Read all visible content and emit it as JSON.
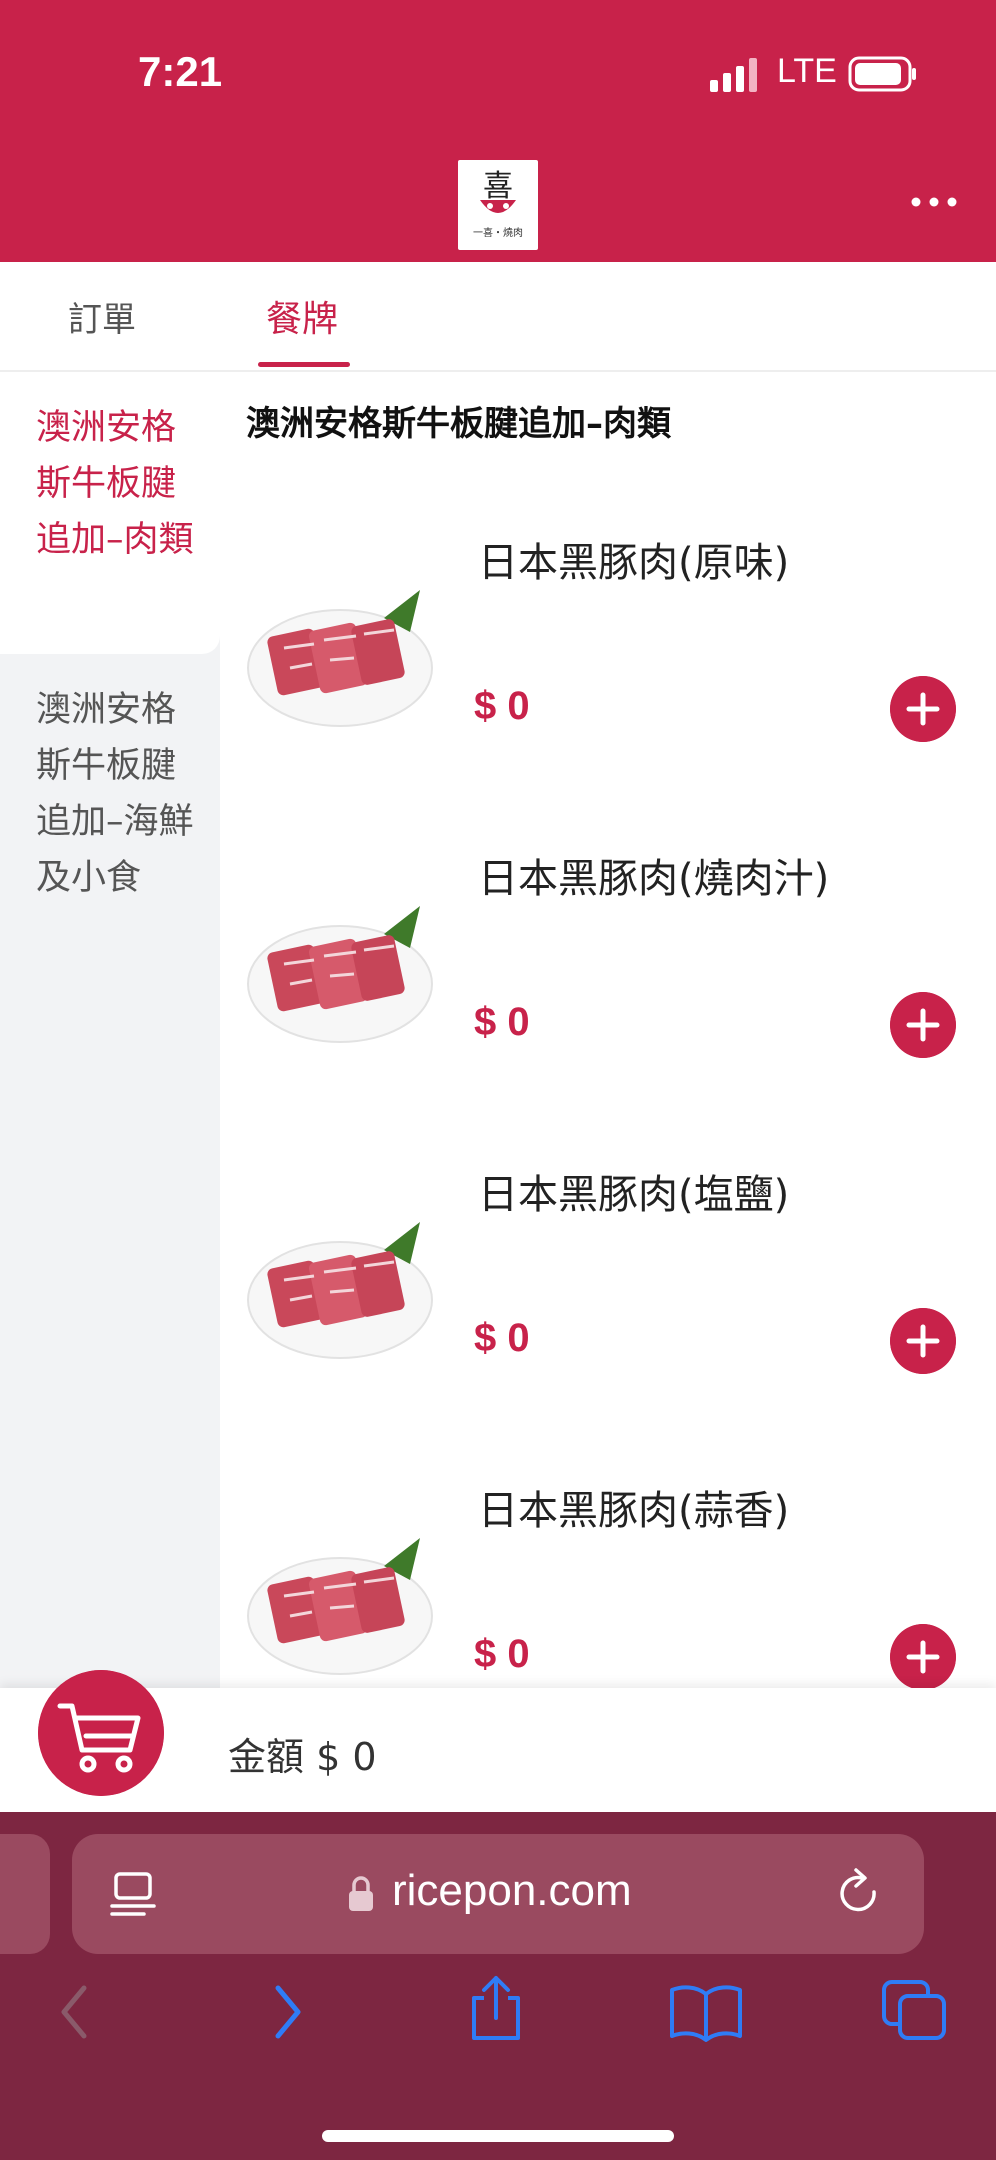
{
  "status_bar": {
    "time": "7:21",
    "network": "LTE"
  },
  "header": {
    "logo_text": "一喜・燒肉"
  },
  "tabs": [
    {
      "label": "訂單"
    },
    {
      "label": "餐牌"
    }
  ],
  "sidebar": {
    "items": [
      {
        "label": "澳洲安格斯牛板腱追加–肉類",
        "active": true
      },
      {
        "label": "澳洲安格斯牛板腱追加–海鮮及小食",
        "active": false
      }
    ]
  },
  "section": {
    "title": "澳洲安格斯牛板腱追加–肉類"
  },
  "menu_items": [
    {
      "name": "日本黑豚肉(原味)",
      "price": "$ 0"
    },
    {
      "name": "日本黑豚肉(燒肉汁)",
      "price": "$ 0"
    },
    {
      "name": "日本黑豚肉(塩鹽)",
      "price": "$ 0"
    },
    {
      "name": "日本黑豚肉(蒜香)",
      "price": "$ 0"
    }
  ],
  "cart": {
    "total_label": "金額 $ 0"
  },
  "browser": {
    "url": "ricepon.com"
  },
  "colors": {
    "brand": "#c8224a",
    "browser_chrome": "#7d2641",
    "sidebar_bg": "#f2f3f5",
    "ios_link": "#2f7cf6"
  },
  "icons": [
    "signal-icon",
    "battery-icon",
    "more-icon",
    "cart-icon",
    "plus-icon",
    "lock-icon",
    "reader-icon",
    "reload-icon",
    "back-icon",
    "forward-icon",
    "share-icon",
    "bookmarks-icon",
    "tabs-icon"
  ]
}
